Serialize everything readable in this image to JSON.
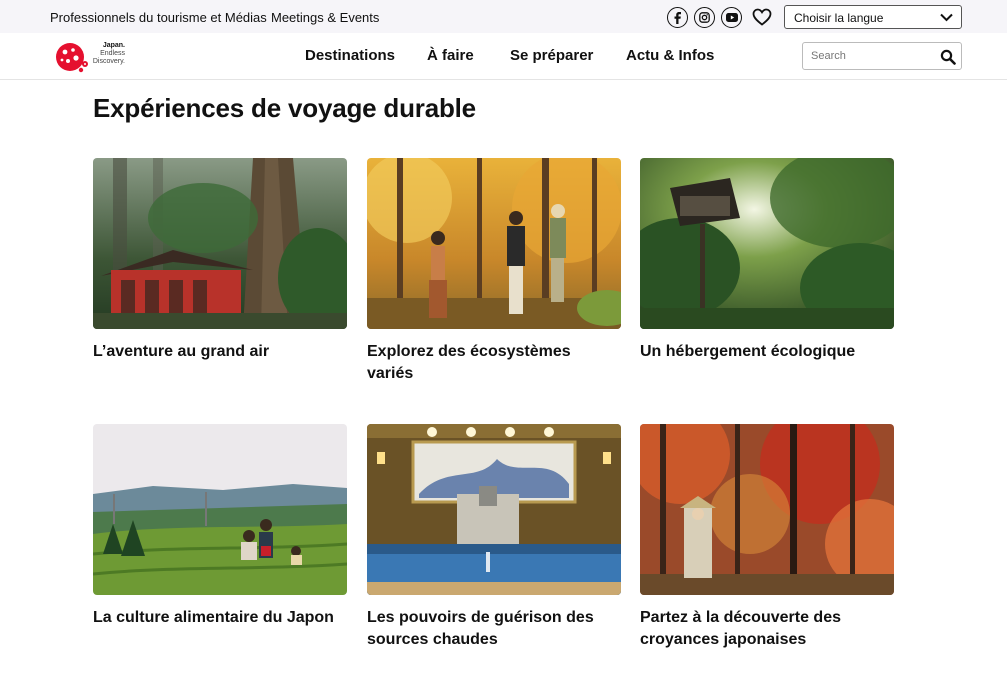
{
  "topbar": {
    "link_pro": "Professionnels du tourisme et Médias",
    "link_meetings": "Meetings & Events",
    "language_select": "Choisir la langue",
    "social_icons": [
      "facebook-icon",
      "instagram-icon",
      "youtube-icon"
    ],
    "favorite_icon": "heart-icon"
  },
  "logo": {
    "line1": "Japan.",
    "line2": "Endless",
    "line3": "Discovery."
  },
  "nav": {
    "items": [
      "Destinations",
      "À faire",
      "Se préparer",
      "Actu & Infos"
    ]
  },
  "search": {
    "placeholder": "Search",
    "icon": "magnifier-icon"
  },
  "main": {
    "title": "Expériences de voyage durable",
    "cards": [
      {
        "title": "L’aventure au grand air"
      },
      {
        "title": "Explorez des écosystèmes variés"
      },
      {
        "title": "Un hébergement écologique"
      },
      {
        "title": "La culture alimentaire du Japon"
      },
      {
        "title": "Les pouvoirs de guérison des sources chaudes"
      },
      {
        "title": "Partez à la découverte des croyances japonaises"
      }
    ]
  },
  "colors": {
    "brand_red": "#e5102f",
    "topbar_bg": "#f6f5f9",
    "text": "#111111"
  }
}
